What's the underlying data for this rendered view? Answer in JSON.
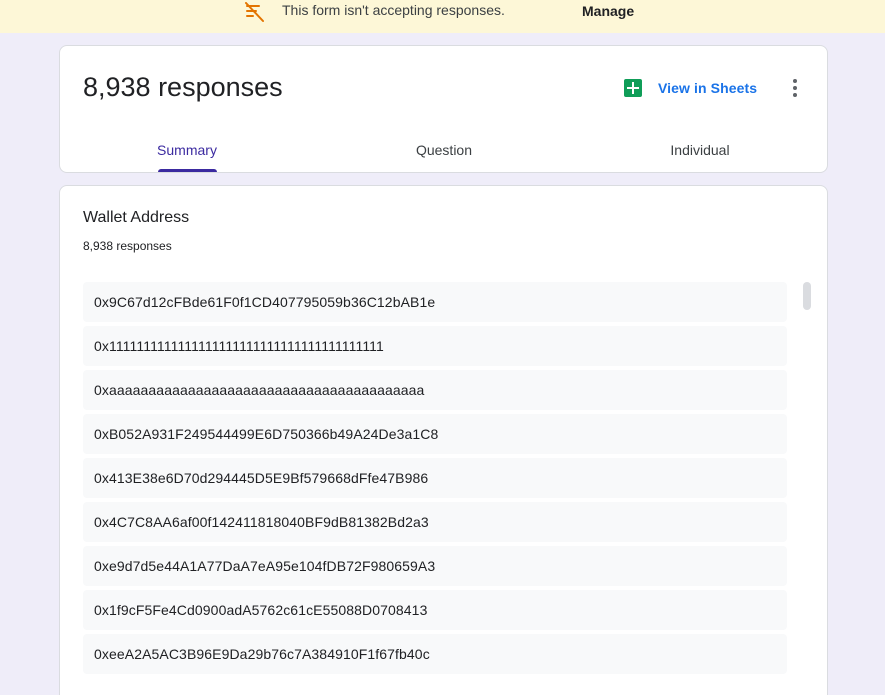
{
  "banner": {
    "icon": "form-closed-icon",
    "text": "This form isn't accepting responses.",
    "manage_label": "Manage"
  },
  "header": {
    "responses_title": "8,938 responses",
    "sheets_label": "View in Sheets",
    "sheets_icon": "sheets-icon",
    "more_icon": "more-vert-icon"
  },
  "tabs": [
    {
      "label": "Summary",
      "active": true
    },
    {
      "label": "Question",
      "active": false
    },
    {
      "label": "Individual",
      "active": false
    }
  ],
  "question": {
    "title": "Wallet Address",
    "count_label": "8,938 responses",
    "answers": [
      "0x9C67d12cFBde61F0f1CD407795059b36C12bAB1e",
      "0x1111111111111111111111111111111111111111",
      "0xaaaaaaaaaaaaaaaaaaaaaaaaaaaaaaaaaaaaaaaa",
      "0xB052A931F249544499E6D750366b49A24De3a1C8",
      "0x413E38e6D70d294445D5E9Bf579668dFfe47B986",
      "0x4C7C8AA6af00f142411818040BF9dB81382Bd2a3",
      "0xe9d7d5e44A1A77DaA7eA95e104fDB72F980659A3",
      "0x1f9cF5Fe4Cd0900adA5762c61cE55088D0708413",
      "0xeeA2A5AC3B96E9Da29b76c7A384910F1f67fb40c"
    ]
  },
  "colors": {
    "accent": "#3b2aa0",
    "link": "#1a73e8",
    "banner_bg": "#fdf7d7",
    "page_bg": "#efedf9",
    "sheets_green": "#0f9d58",
    "closed_icon": "#e37400"
  }
}
